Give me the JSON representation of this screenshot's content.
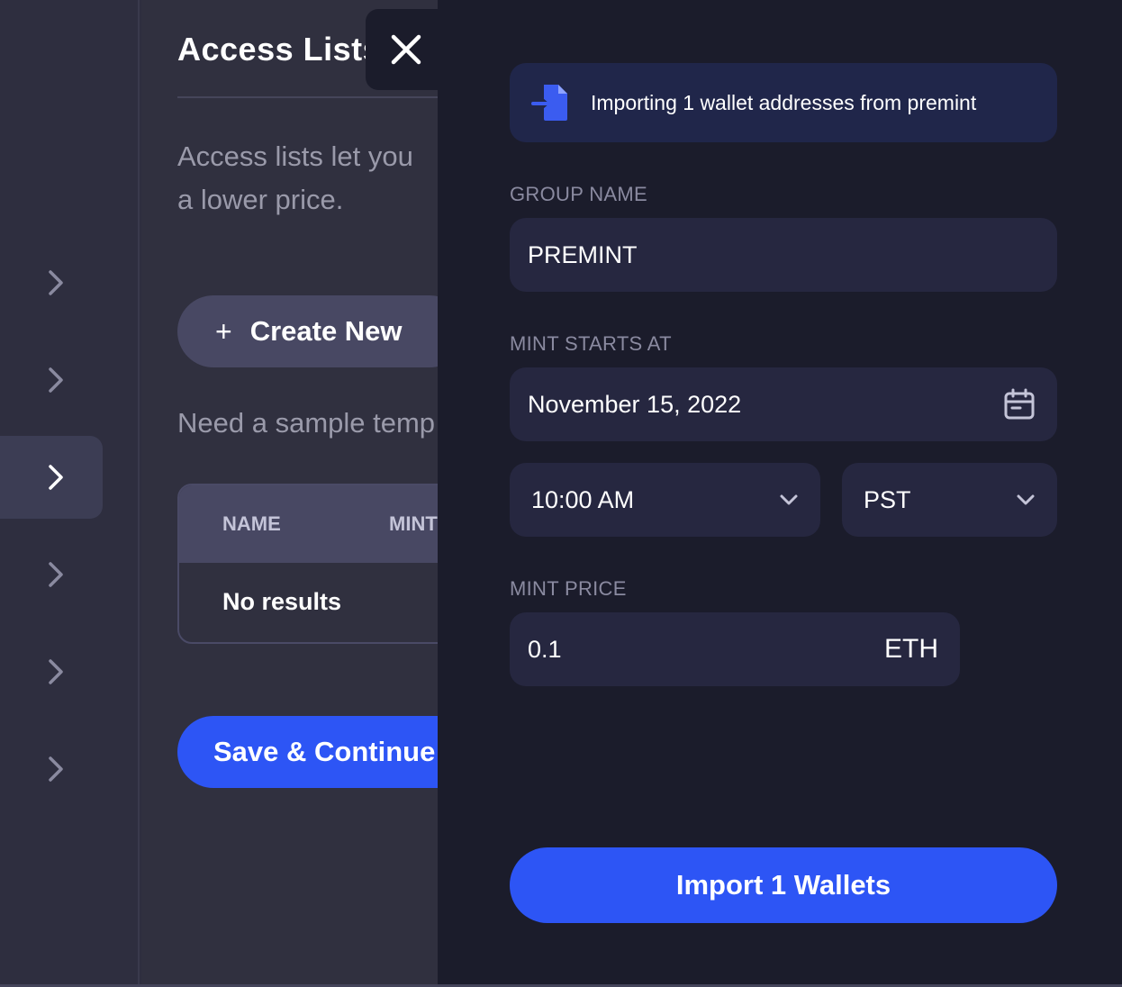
{
  "colors": {
    "accent": "#2d55f5",
    "drawer_bg": "#1b1c2b",
    "panel_bg": "#30303f",
    "field_bg": "#262740",
    "banner_bg": "#20264a"
  },
  "rail": {
    "items": [
      {
        "icon": "chevron-right-icon",
        "active": false
      },
      {
        "icon": "chevron-right-icon",
        "active": false
      },
      {
        "icon": "chevron-right-icon",
        "active": true
      },
      {
        "icon": "chevron-right-icon",
        "active": false
      },
      {
        "icon": "chevron-right-icon",
        "active": false
      },
      {
        "icon": "chevron-right-icon",
        "active": false
      }
    ]
  },
  "panel": {
    "title": "Access Lists",
    "description_line1": "Access lists let you",
    "description_line2": "a lower price.",
    "create_plus": "+",
    "create_label": "Create New",
    "sample_text": "Need a sample temp",
    "table": {
      "headers": [
        "NAME",
        "MINT"
      ],
      "empty_text": "No results"
    },
    "save_label": "Save & Continue"
  },
  "drawer": {
    "close_icon": "close-icon",
    "banner_icon": "file-import-icon",
    "banner_text": "Importing 1 wallet addresses from premint",
    "group_name_label": "GROUP NAME",
    "group_name_value": "PREMINT",
    "mint_starts_label": "MINT STARTS AT",
    "mint_date_value": "November 15, 2022",
    "calendar_icon": "calendar-icon",
    "time_value": "10:00 AM",
    "timezone_value": "PST",
    "mint_price_label": "MINT PRICE",
    "mint_price_value": "0.1",
    "mint_price_unit": "ETH",
    "import_button_label": "Import 1 Wallets"
  }
}
